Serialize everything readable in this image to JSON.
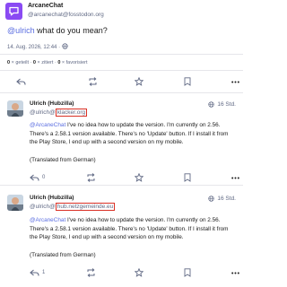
{
  "status": {
    "author_name": "ArcaneChat",
    "author_handle": "@arcanechat@fosstodon.org",
    "mention": "@ulrich",
    "text": " what do you mean?",
    "date": "14. Aug. 2026, 12:44",
    "visibility_sep": "·",
    "stats": {
      "boosts_count": "0",
      "boosts_label": "× geteilt",
      "quotes_count": "0",
      "quotes_label": "× zitiert",
      "favs_count": "0",
      "favs_label": "× favorisiert"
    },
    "app_icon": "chat-bubble-icon"
  },
  "replies": [
    {
      "author_name": "Ulrich (Hubzilla)",
      "handle_user": "@ulrich@",
      "handle_domain": "klacker.org",
      "time": "16 Std.",
      "mention": "@ArcaneChat",
      "text": " I've no idea how to update the version. I'm currently on 2.56. There's a 2.58.1 version available. There's no 'Update' button. If I install it from the Play Store, I end up with a second version on my mobile.",
      "translated": "(Translated from German)",
      "reply_count": "0"
    },
    {
      "author_name": "Ulrich (Hubzilla)",
      "handle_user": "@ulrich@",
      "handle_domain": "hub.netzgemeinde.eu",
      "time": "16 Std.",
      "mention": "@ArcaneChat",
      "text": " I've no idea how to update the version. I'm currently on 2.56. There's a 2.58.1 version available. There's no 'Update' button. If I install it from the Play Store, I end up with a second version on my mobile.",
      "translated": "(Translated from German)",
      "reply_count": "1"
    }
  ],
  "colors": {
    "accent": "#5b6ee1",
    "muted": "#606984",
    "highlight_border": "#d93025",
    "app_avatar": "#8a4af3"
  }
}
